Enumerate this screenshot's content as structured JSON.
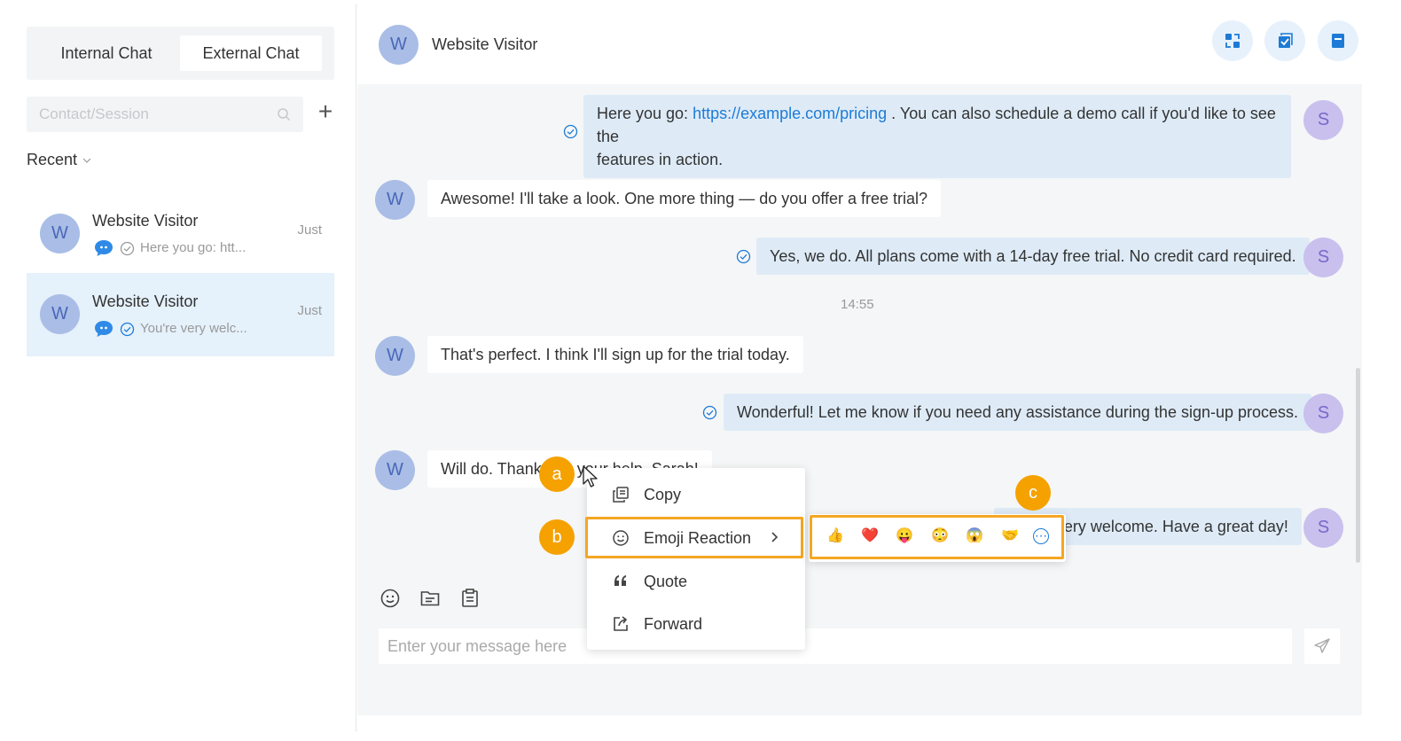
{
  "left": {
    "tabs": [
      "Internal Chat",
      "External Chat"
    ],
    "search_placeholder": "Contact/Session",
    "add_label": "+",
    "recent_label": "Recent",
    "conversations": [
      {
        "avatar": "W",
        "name": "Website Visitor",
        "time": "Just",
        "preview": "Here you go: htt..."
      },
      {
        "avatar": "W",
        "name": "Website Visitor",
        "time": "Just",
        "preview": "You're very welc..."
      }
    ]
  },
  "header": {
    "avatar": "W",
    "name": "Website Visitor"
  },
  "messages": {
    "m1_prefix": "Here you go: ",
    "m1_link": "https://example.com/pricing",
    "m1_suffix": " . You can also schedule a demo call if you'd like to see the",
    "m1_line2": "features in action.",
    "m2": "Awesome! I'll take a look. One more thing — do you offer a free trial?",
    "m3": "Yes, we do. All plans come with a 14-day free trial. No credit card required.",
    "timestamp": "14:55",
    "m4": "That's perfect. I think I'll sign up for the trial today.",
    "m5": "Wonderful! Let me know if you need any assistance during the sign-up process.",
    "m6": "Will do. Thanks for your help, Sarah!",
    "m7": "You're very welcome. Have a great day!",
    "visitor_avatar": "W",
    "agent_avatar": "S"
  },
  "composer": {
    "placeholder": "Enter your message here"
  },
  "context_menu": {
    "items": [
      "Copy",
      "Emoji Reaction",
      "Quote",
      "Forward"
    ]
  },
  "emoji_reactions": [
    "👍",
    "❤️",
    "😛",
    "😳",
    "😱",
    "🤝",
    "⋯"
  ],
  "badges": {
    "a": "a",
    "b": "b",
    "c": "c"
  },
  "colors": {
    "accent": "#1d7bd6",
    "highlight": "#f5a623",
    "badge": "#f5a100",
    "outgoing_bubble": "#deebf7",
    "selected_row": "#e5f1fb"
  }
}
